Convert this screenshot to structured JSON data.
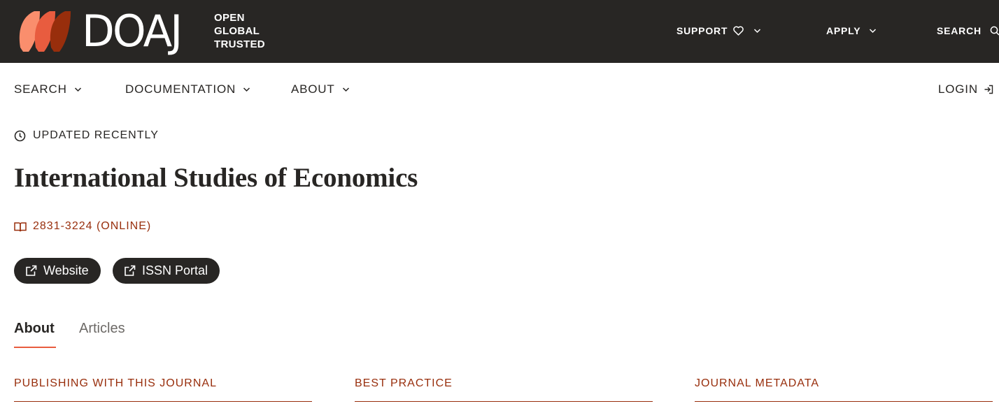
{
  "brand": {
    "wordmark": "DOAJ",
    "tagline": [
      "OPEN",
      "GLOBAL",
      "TRUSTED"
    ],
    "colors": {
      "dark": "#282624",
      "accent": "#e85c3f",
      "link": "#982e0c",
      "logo_light": "#fa8e6d",
      "logo_mid": "#e85c3f",
      "logo_dark": "#982e0c"
    }
  },
  "topnav": {
    "support": "SUPPORT",
    "apply": "APPLY",
    "search": "SEARCH"
  },
  "secnav": {
    "search": "SEARCH",
    "documentation": "DOCUMENTATION",
    "about": "ABOUT",
    "login": "LOGIN"
  },
  "journal": {
    "updated": "UPDATED RECENTLY",
    "title": "International Studies of Economics",
    "issn": "2831-3224 (ONLINE)",
    "buttons": {
      "website": "Website",
      "issn_portal": "ISSN Portal"
    }
  },
  "tabs": {
    "about": "About",
    "articles": "Articles"
  },
  "sections": {
    "publishing": "PUBLISHING WITH THIS JOURNAL",
    "best_practice": "BEST PRACTICE",
    "metadata": "JOURNAL METADATA"
  }
}
